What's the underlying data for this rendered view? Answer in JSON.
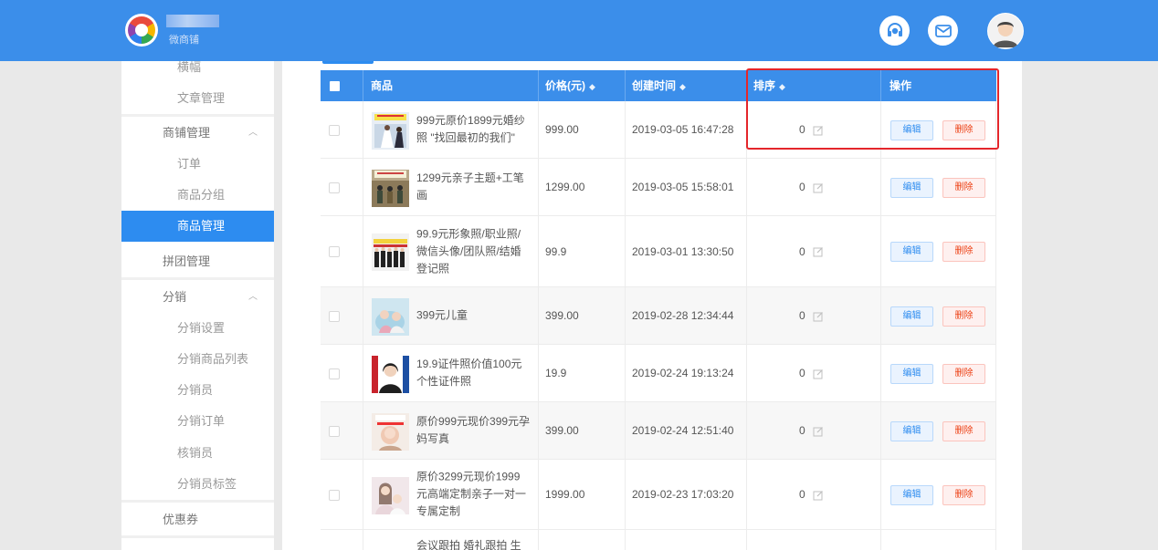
{
  "header": {
    "shop_name": "微商铺",
    "icons": [
      "headset-icon",
      "mail-icon",
      "user-avatar-icon"
    ]
  },
  "sidebar": {
    "items": [
      {
        "label": "横幅",
        "level": 2
      },
      {
        "label": "文章管理",
        "level": 2
      },
      {
        "label": "商铺管理",
        "level": 1,
        "expanded": true
      },
      {
        "label": "订单",
        "level": 2
      },
      {
        "label": "商品分组",
        "level": 2
      },
      {
        "label": "商品管理",
        "level": 2,
        "active": true
      },
      {
        "label": "拼团管理",
        "level": 1
      },
      {
        "label": "分销",
        "level": 1,
        "expanded": true
      },
      {
        "label": "分销设置",
        "level": 2
      },
      {
        "label": "分销商品列表",
        "level": 2
      },
      {
        "label": "分销员",
        "level": 2
      },
      {
        "label": "分销订单",
        "level": 2
      },
      {
        "label": "核销员",
        "level": 2
      },
      {
        "label": "分销员标签",
        "level": 2
      },
      {
        "label": "优惠券",
        "level": 1
      }
    ]
  },
  "table": {
    "columns": {
      "product": "商品",
      "price": "价格(元)",
      "created": "创建时间",
      "sort": "排序",
      "actions": "操作"
    },
    "edit_label": "编辑",
    "delete_label": "删除",
    "rows": [
      {
        "name": "999元原价1899元婚纱照 \"找回最初的我们\"",
        "price": "999.00",
        "created": "2019-03-05 16:47:28",
        "sort": "0"
      },
      {
        "name": "1299元亲子主题+工笔画",
        "price": "1299.00",
        "created": "2019-03-05 15:58:01",
        "sort": "0"
      },
      {
        "name": "99.9元形象照/职业照/微信头像/团队照/结婚登记照",
        "price": "99.9",
        "created": "2019-03-01 13:30:50",
        "sort": "0"
      },
      {
        "name": "399元儿童",
        "price": "399.00",
        "created": "2019-02-28 12:34:44",
        "sort": "0"
      },
      {
        "name": "19.9证件照价值100元个性证件照",
        "price": "19.9",
        "created": "2019-02-24 19:13:24",
        "sort": "0"
      },
      {
        "name": "原价999元现价399元孕妈写真",
        "price": "399.00",
        "created": "2019-02-24 12:51:40",
        "sort": "0"
      },
      {
        "name": "原价3299元现价1999元高端定制亲子一对一专属定制",
        "price": "1999.00",
        "created": "2019-02-23 17:03:20",
        "sort": "0"
      },
      {
        "name": "会议跟拍 婚礼跟拍 生",
        "price": "",
        "created": "",
        "sort": ""
      }
    ]
  },
  "colors": {
    "header_bg": "#3b8eea",
    "accent": "#2d8cf0",
    "danger": "#ed4014",
    "highlight_box": "#e4262b"
  }
}
